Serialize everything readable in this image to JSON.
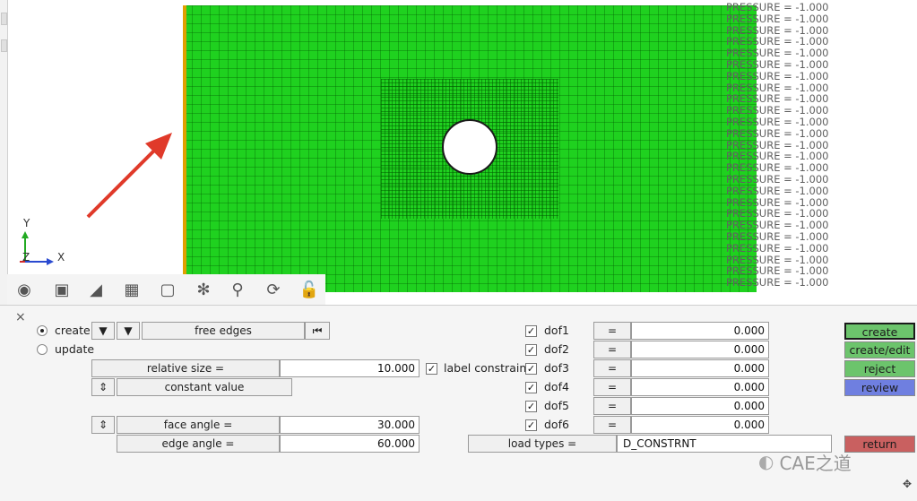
{
  "viewport": {
    "pressure_label": "PRESSURE = -1.000",
    "pressure_count": 25,
    "axis_y": "Y",
    "axis_z": "Z",
    "axis_x": "X"
  },
  "toolbar": {
    "icons": [
      "eye-icon",
      "camera-icon",
      "surface-icon",
      "cube-icon",
      "cut-icon",
      "axes-icon",
      "zoom-icon",
      "rotate-icon",
      "lock-icon"
    ]
  },
  "panel": {
    "close_glyph": "×",
    "create_radio": "create",
    "update_radio": "update",
    "free_edges": "free edges",
    "relative_size_label": "relative size =",
    "relative_size_value": "10.000",
    "label_constraints": "label constraint",
    "constant_value": "constant value",
    "face_angle_label": "face angle =",
    "face_angle_value": "30.000",
    "edge_angle_label": "edge angle =",
    "edge_angle_value": "60.000",
    "dofs": [
      {
        "name": "dof1",
        "eq": "=",
        "value": "0.000"
      },
      {
        "name": "dof2",
        "eq": "=",
        "value": "0.000"
      },
      {
        "name": "dof3",
        "eq": "=",
        "value": "0.000"
      },
      {
        "name": "dof4",
        "eq": "=",
        "value": "0.000"
      },
      {
        "name": "dof5",
        "eq": "=",
        "value": "0.000"
      },
      {
        "name": "dof6",
        "eq": "=",
        "value": "0.000"
      }
    ],
    "load_types_label": "load types =",
    "load_types_value": "D_CONSTRNT",
    "actions": {
      "create": "create",
      "create_edit": "create/edit",
      "reject": "reject",
      "review": "review",
      "return": "return"
    },
    "watermark": "CAE之道"
  },
  "colors": {
    "mesh": "#1fd11f",
    "create": "#6cc46c",
    "review": "#6f7fe0",
    "return": "#c96060",
    "arrow": "#e03a2a"
  }
}
